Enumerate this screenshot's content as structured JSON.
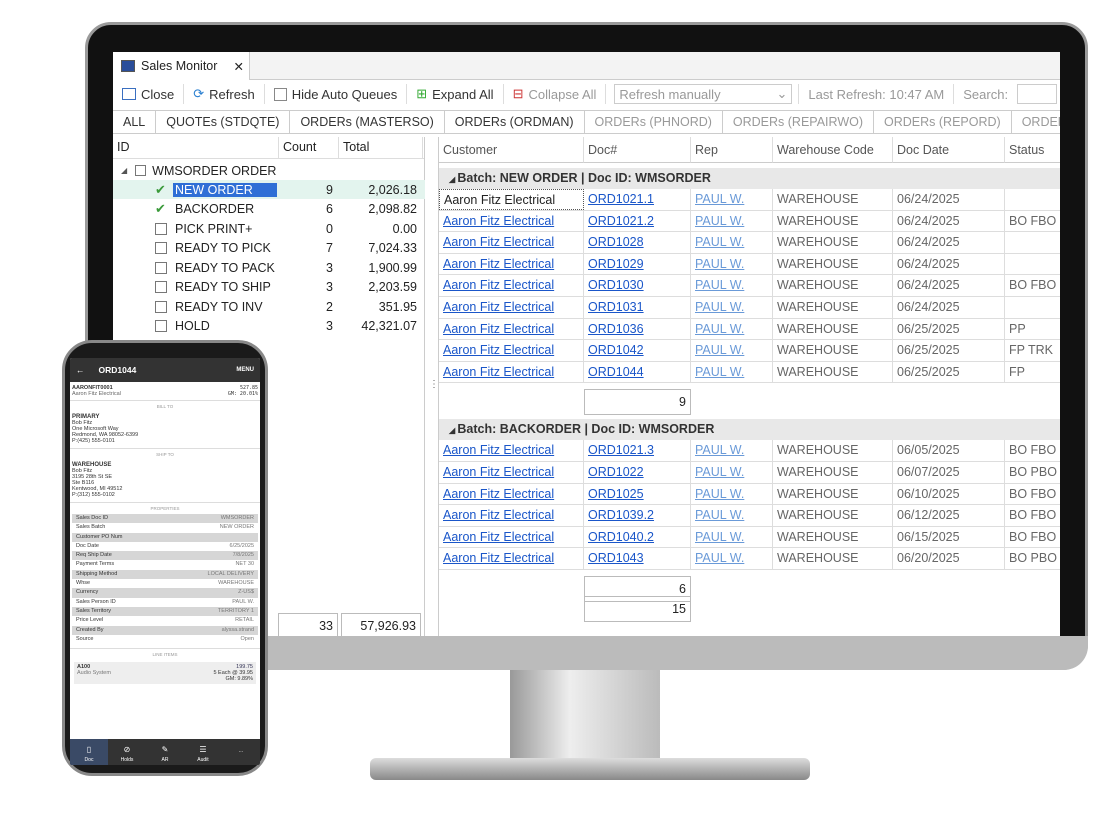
{
  "window": {
    "tab_title": "Sales Monitor",
    "close_tab": "✕"
  },
  "toolbar": {
    "close": "Close",
    "refresh": "Refresh",
    "hide_auto_queues": "Hide Auto Queues",
    "expand_all": "Expand All",
    "collapse_all": "Collapse All",
    "refresh_mode": "Refresh manually",
    "last_refresh": "Last Refresh: 10:47 AM",
    "search_label": "Search:"
  },
  "queue_tabs": [
    "ALL",
    "QUOTEs (STDQTE)",
    "ORDERs (MASTERSO)",
    "ORDERs (ORDMAN)",
    "ORDERs (PHNORD)",
    "ORDERs (REPAIRWO)",
    "ORDERs (REPORD)",
    "ORDERs (RMAORD)"
  ],
  "tree": {
    "headers": [
      "ID",
      "Count",
      "Total"
    ],
    "root": "WMSORDER ORDER",
    "items": [
      {
        "label": "NEW ORDER",
        "count": "9",
        "total": "2,026.18",
        "checked": true,
        "selected": true
      },
      {
        "label": "BACKORDER",
        "count": "6",
        "total": "2,098.82",
        "checked": true
      },
      {
        "label": "PICK PRINT+",
        "count": "0",
        "total": "0.00"
      },
      {
        "label": "READY TO PICK",
        "count": "7",
        "total": "7,024.33"
      },
      {
        "label": "READY TO PACK",
        "count": "3",
        "total": "1,900.99"
      },
      {
        "label": "READY TO SHIP",
        "count": "3",
        "total": "2,203.59"
      },
      {
        "label": "READY TO INV",
        "count": "2",
        "total": "351.95"
      },
      {
        "label": "HOLD",
        "count": "3",
        "total": "42,321.07"
      }
    ],
    "total_count": "33",
    "total_amount": "57,926.93"
  },
  "grid": {
    "headers": [
      "Customer",
      "Doc#",
      "Rep",
      "Warehouse Code",
      "Doc Date",
      "Status"
    ],
    "groups": [
      {
        "title": "Batch: NEW ORDER | Doc ID: WMSORDER",
        "count": "9",
        "rows": [
          [
            "Aaron Fitz Electrical",
            "ORD1021.1",
            "PAUL W.",
            "WAREHOUSE",
            "06/24/2025",
            ""
          ],
          [
            "Aaron Fitz Electrical",
            "ORD1021.2",
            "PAUL W.",
            "WAREHOUSE",
            "06/24/2025",
            "BO FBO"
          ],
          [
            "Aaron Fitz Electrical",
            "ORD1028",
            "PAUL W.",
            "WAREHOUSE",
            "06/24/2025",
            ""
          ],
          [
            "Aaron Fitz Electrical",
            "ORD1029",
            "PAUL W.",
            "WAREHOUSE",
            "06/24/2025",
            ""
          ],
          [
            "Aaron Fitz Electrical",
            "ORD1030",
            "PAUL W.",
            "WAREHOUSE",
            "06/24/2025",
            "BO FBO"
          ],
          [
            "Aaron Fitz Electrical",
            "ORD1031",
            "PAUL W.",
            "WAREHOUSE",
            "06/24/2025",
            ""
          ],
          [
            "Aaron Fitz Electrical",
            "ORD1036",
            "PAUL W.",
            "WAREHOUSE",
            "06/25/2025",
            "PP"
          ],
          [
            "Aaron Fitz Electrical",
            "ORD1042",
            "PAUL W.",
            "WAREHOUSE",
            "06/25/2025",
            "FP TRK"
          ],
          [
            "Aaron Fitz Electrical",
            "ORD1044",
            "PAUL W.",
            "WAREHOUSE",
            "06/25/2025",
            "FP"
          ]
        ]
      },
      {
        "title": "Batch: BACKORDER | Doc ID: WMSORDER",
        "count": "6",
        "rows": [
          [
            "Aaron Fitz Electrical",
            "ORD1021.3",
            "PAUL W.",
            "WAREHOUSE",
            "06/05/2025",
            "BO FBO"
          ],
          [
            "Aaron Fitz Electrical",
            "ORD1022",
            "PAUL W.",
            "WAREHOUSE",
            "06/07/2025",
            "BO PBO"
          ],
          [
            "Aaron Fitz Electrical",
            "ORD1025",
            "PAUL W.",
            "WAREHOUSE",
            "06/10/2025",
            "BO FBO EI"
          ],
          [
            "Aaron Fitz Electrical",
            "ORD1039.2",
            "PAUL W.",
            "WAREHOUSE",
            "06/12/2025",
            "BO FBO"
          ],
          [
            "Aaron Fitz Electrical",
            "ORD1040.2",
            "PAUL W.",
            "WAREHOUSE",
            "06/15/2025",
            "BO FBO"
          ],
          [
            "Aaron Fitz Electrical",
            "ORD1043",
            "PAUL W.",
            "WAREHOUSE",
            "06/20/2025",
            "BO PBO PI"
          ]
        ]
      }
    ],
    "grand_total": "15"
  },
  "phone": {
    "title": "ORD1044",
    "menu": "MENU",
    "customer_id": "AARONFIT0001",
    "customer_name": "Aaron Fitz Electrical",
    "amount": "527.85",
    "gm": "GM: 20.01%",
    "bill_to_label": "BILL TO",
    "bill_to": [
      "PRIMARY",
      "Bob Fitz",
      "One Microsoft Way",
      "Redmond, WA 98052-6399",
      "P:(425) 555-0101"
    ],
    "ship_to_label": "SHIP TO",
    "ship_to": [
      "WAREHOUSE",
      "Bob Fitz",
      "3195 28th St SE",
      "Ste B116",
      "Kentwood, MI 49512",
      "P:(312) 555-0102"
    ],
    "properties_label": "PROPERTIES",
    "properties": [
      [
        "Sales Doc ID",
        "WMSORDER"
      ],
      [
        "Sales Batch",
        "NEW ORDER"
      ],
      [
        "Customer PO Num",
        ""
      ],
      [
        "Doc Date",
        "6/25/2025"
      ],
      [
        "Req Ship Date",
        "7/8/2025"
      ],
      [
        "Payment Terms",
        "NET 30"
      ],
      [
        "Shipping Method",
        "LOCAL DELIVERY"
      ],
      [
        "Whse",
        "WAREHOUSE"
      ],
      [
        "Currency",
        "Z-US$"
      ],
      [
        "Sales Person ID",
        "PAUL W."
      ],
      [
        "Sales Territory",
        "TERRITORY 1"
      ],
      [
        "Price Level",
        "RETAIL"
      ],
      [
        "Created By",
        "alyssa.strand"
      ],
      [
        "Source",
        "Open"
      ]
    ],
    "line_items_label": "LINE ITEMS",
    "line_item": {
      "id": "A100",
      "desc": "Audio System",
      "amount": "199.75",
      "qty": "5 Each @ 39.95",
      "gm": "GM: 9.89%"
    },
    "nav": [
      "Doc",
      "Holds",
      "AR",
      "Audit",
      "..."
    ]
  }
}
